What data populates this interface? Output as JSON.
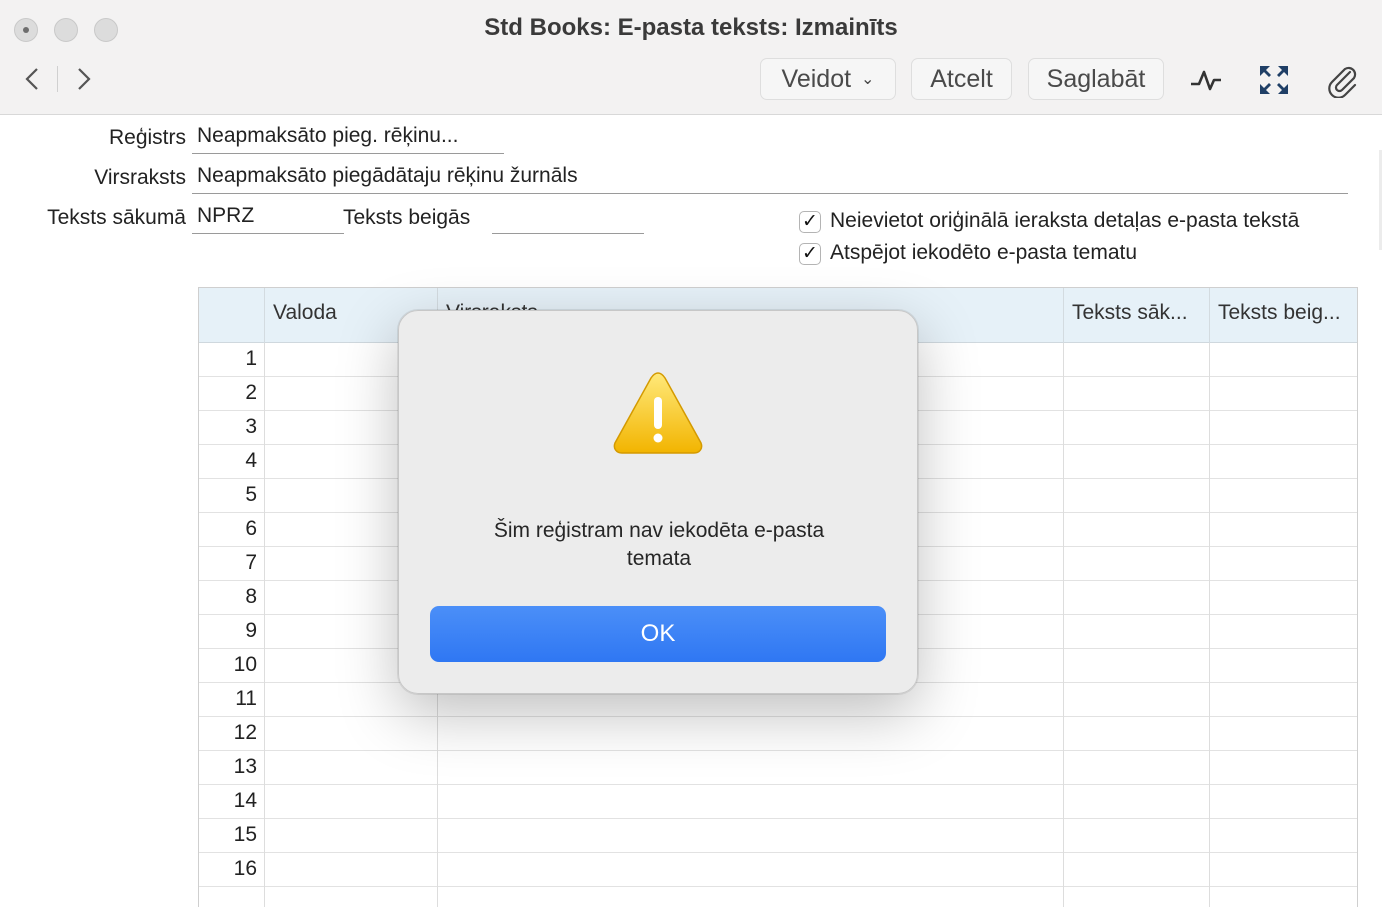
{
  "window": {
    "title": "Std Books: E-pasta teksts: Izmainīts"
  },
  "toolbar": {
    "create_label": "Veidot",
    "cancel_label": "Atcelt",
    "save_label": "Saglabāt",
    "icons": [
      "back-icon",
      "forward-icon",
      "activity-icon",
      "expand-icon",
      "attachment-icon"
    ]
  },
  "form": {
    "register_label": "Reģistrs",
    "register_value": "Neapmaksāto pieg. rēķinu...",
    "heading_label": "Virsraksts",
    "heading_value": "Neapmaksāto piegādātaju rēķinu žurnāls",
    "text_start_label": "Teksts sākumā",
    "text_start_value": "NPRZ",
    "text_end_label": "Teksts beigās",
    "text_end_value": "",
    "checkbox1_label": "Neievietot oriģinālā ieraksta detaļas e-pasta tekstā",
    "checkbox1_checked": true,
    "checkbox2_label": "Atspējot iekodēto e-pasta tematu",
    "checkbox2_checked": true
  },
  "grid": {
    "columns": [
      "Valoda",
      "Virsraksts",
      "Teksts sāk...",
      "Teksts beig..."
    ],
    "rows": [
      "1",
      "2",
      "3",
      "4",
      "5",
      "6",
      "7",
      "8",
      "9",
      "10",
      "11",
      "12",
      "13",
      "14",
      "15",
      "16"
    ]
  },
  "dialog": {
    "message": "Šim reģistram nav iekodēta e-pasta temata",
    "ok_label": "OK",
    "icon": "warning-icon",
    "button_color": "#3a82f6"
  }
}
